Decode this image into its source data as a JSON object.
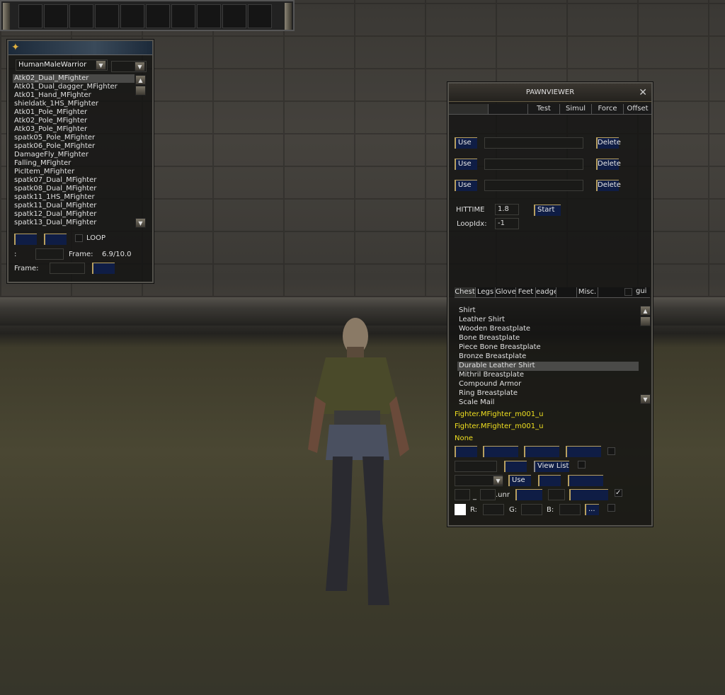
{
  "anim_window": {
    "class_select": "HumanMaleWarrior",
    "animations": [
      "Atk02_Dual_MFighter",
      "Atk01_Dual_dagger_MFighter",
      "Atk01_Hand_MFighter",
      "shieldatk_1HS_MFighter",
      "Atk01_Pole_MFighter",
      "Atk02_Pole_MFighter",
      "Atk03_Pole_MFighter",
      "spatk05_Pole_MFighter",
      "spatk06_Pole_MFighter",
      "DamageFly_MFighter",
      "Falling_MFighter",
      "PicItem_MFighter",
      "spatk07_Dual_MFighter",
      "spatk08_Dual_MFighter",
      "spatk11_1HS_MFighter",
      "spatk11_Dual_MFighter",
      "spatk12_Dual_MFighter",
      "spatk13_Dual_MFighter"
    ],
    "selected_index": 0,
    "loop_label": "LOOP",
    "colon_label": ":",
    "frame_label": "Frame:",
    "frame_value": "6.9/10.0",
    "frame_label2": "Frame:"
  },
  "pawnviewer": {
    "title": "PAWNVIEWER",
    "tabs": [
      "",
      "",
      "Test",
      "Simul",
      "Force",
      "Offset"
    ],
    "use_label": "Use",
    "delete_label": "Delete",
    "hittime_label": "HITTIME",
    "hittime_value": "1.8",
    "start_label": "Start",
    "loopidx_label": "LoopIdx:",
    "loopidx_value": "-1",
    "part_tabs": [
      "Chest",
      "Legs",
      "Gloves",
      "Feet",
      "eadge",
      "",
      "Misc."
    ],
    "gui_label": "gui",
    "items": [
      "Shirt",
      "Leather Shirt",
      "Wooden Breastplate",
      "Bone Breastplate",
      "Piece Bone Breastplate",
      "Bronze Breastplate",
      "Durable Leather Shirt",
      "Mithril Breastplate",
      "Compound Armor",
      "Ring Breastplate",
      "Scale Mail"
    ],
    "selected_item": 6,
    "mesh1": "Fighter.MFighter_m001_u",
    "mesh2": "Fighter.MFighter_m001_u",
    "mesh3": "None",
    "view_list_label": "View List",
    "use2_label": "Use",
    "underscore": "_",
    "unr_label": ".unr",
    "r_label": "R:",
    "g_label": "G:",
    "b_label": "B:",
    "ellipsis_label": "...",
    "color_swatch": "#ffffff"
  }
}
